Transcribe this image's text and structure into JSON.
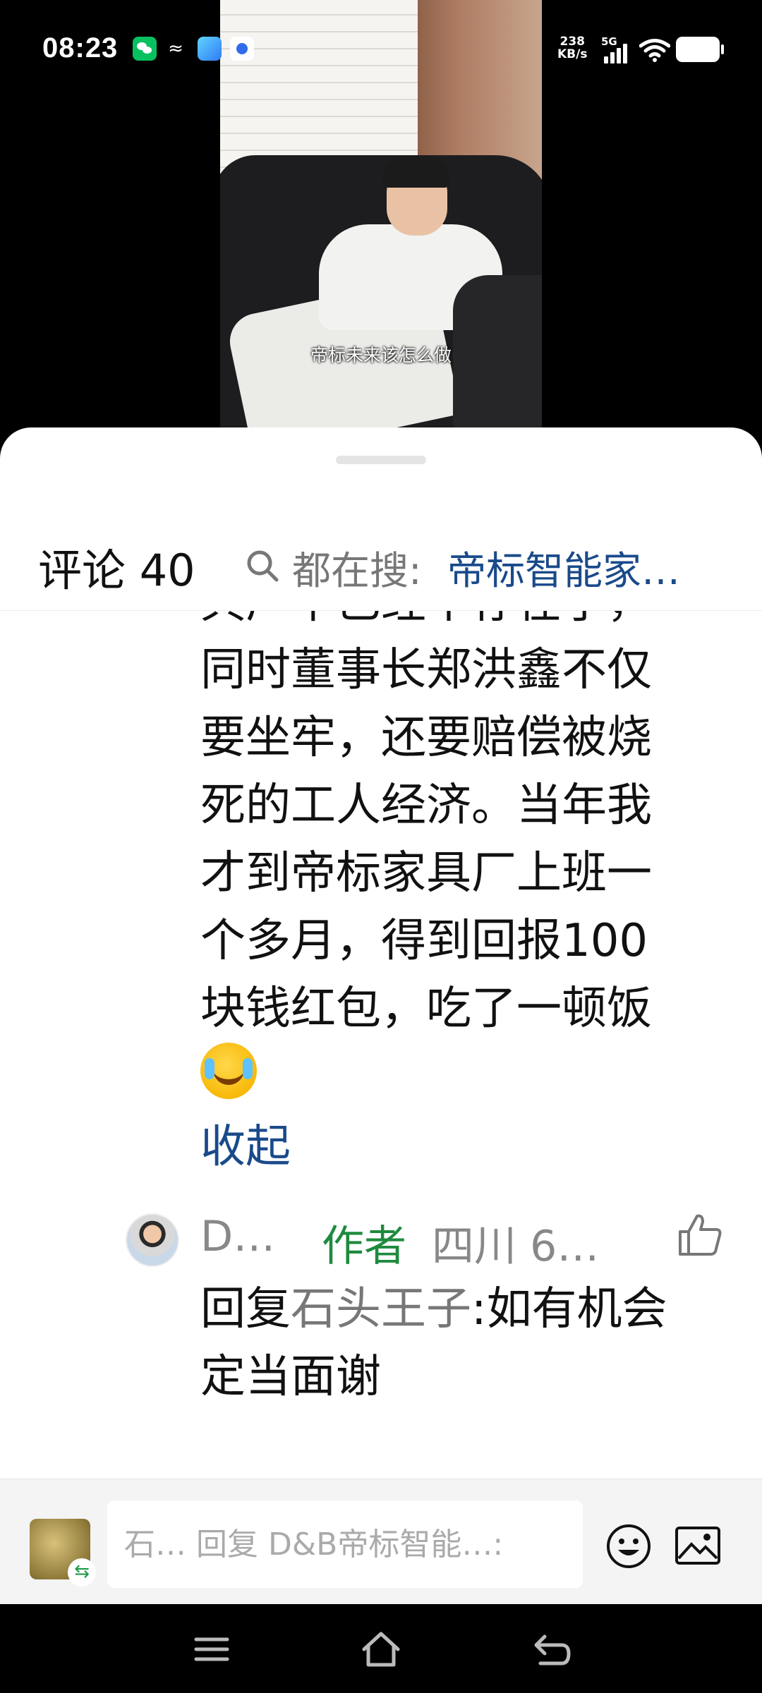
{
  "status_bar": {
    "time": "08:23",
    "net_speed_value": "238",
    "net_speed_unit": "KB/s",
    "network_type": "5G",
    "icons": [
      "wechat-icon",
      "mix-icon",
      "plane-app-icon",
      "baidu-icon",
      "signal-icon",
      "wifi-icon",
      "battery-icon"
    ]
  },
  "video": {
    "subtitle": "帝标未来该怎么做"
  },
  "header": {
    "title": "评论 40",
    "search_prefix": "都在搜:",
    "search_term": "帝标智能家…"
  },
  "comment": {
    "cut_line": "具厂早已经不存在了，",
    "lines": [
      "同时董事长郑洪鑫不仅",
      "要坐牢，还要赔偿被烧",
      "死的工人经济。当年我",
      "才到帝标家具厂上班一",
      "个多月，得到回报100",
      "块钱红包，吃了一顿饭"
    ],
    "emoji": "facepalm-laugh-emoji",
    "collapse_label": "收起"
  },
  "reply": {
    "name": "D…",
    "author_badge": "作者",
    "meta": "四川 6…",
    "prefix": "回复",
    "quoted_user": "石头王子",
    "text_line1_rest": ":如有机会",
    "text_line2": "定当面谢"
  },
  "input_bar": {
    "placeholder": "石… 回复 D&B帝标智能…:",
    "swap_symbol": "⇆"
  },
  "colors": {
    "link_blue": "#1a4a8a",
    "author_green": "#1e8a3e"
  }
}
